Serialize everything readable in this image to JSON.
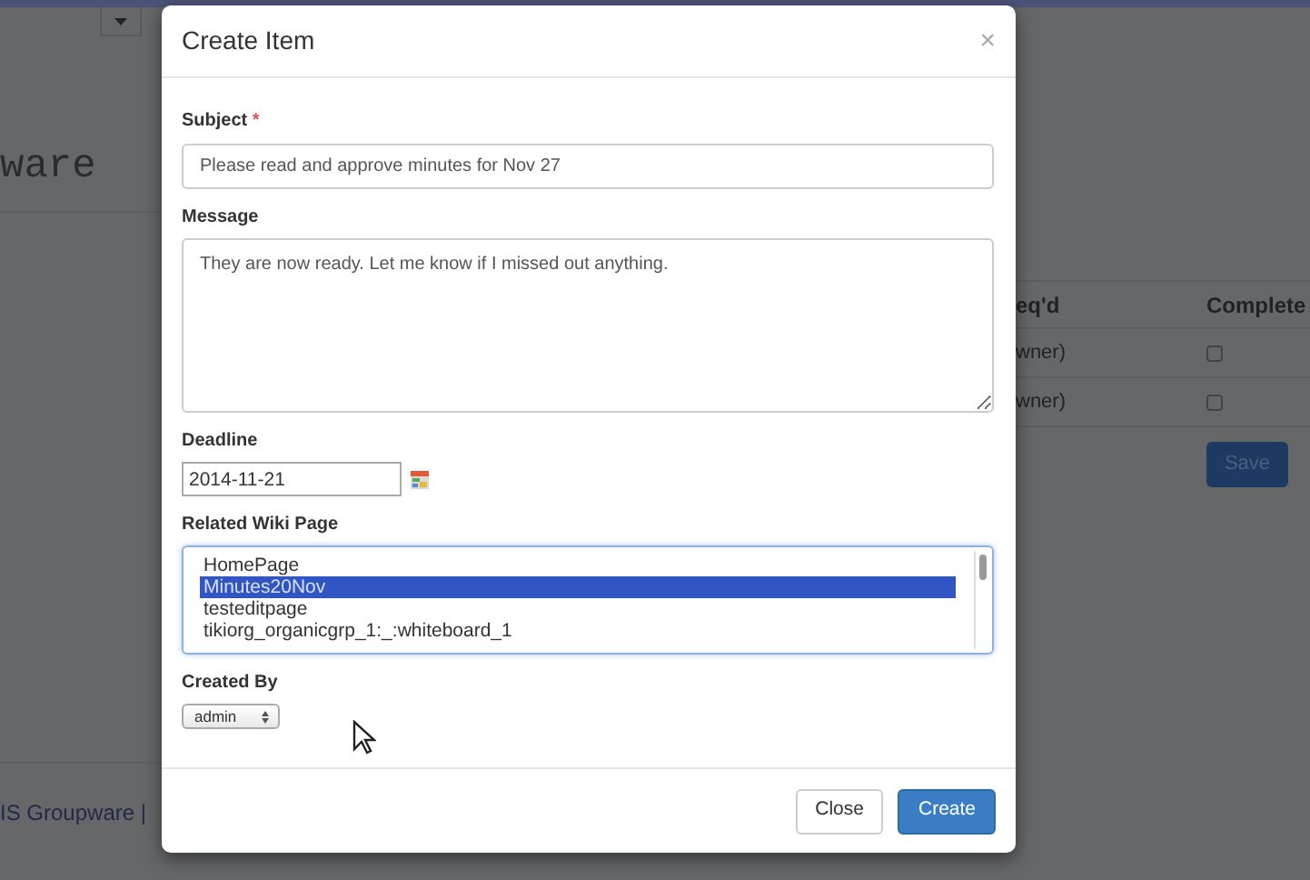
{
  "background": {
    "heading": "ware",
    "footer": "IS Groupware |",
    "table": {
      "columns": [
        "eq'd",
        "Complete"
      ],
      "rows": [
        {
          "cell": "wner)",
          "checked": false
        },
        {
          "cell": "wner)",
          "checked": false
        }
      ]
    },
    "save_button": "Save"
  },
  "modal": {
    "title": "Create Item",
    "close": "×",
    "subject": {
      "label": "Subject",
      "required_marker": "*",
      "value": "Please read and approve minutes for Nov 27"
    },
    "message": {
      "label": "Message",
      "value": "They are now ready. Let me know if I missed out anything."
    },
    "deadline": {
      "label": "Deadline",
      "value": "2014-11-21"
    },
    "related_wiki_page": {
      "label": "Related Wiki Page",
      "options": [
        {
          "text": "HomePage",
          "selected": false
        },
        {
          "text": "Minutes20Nov",
          "selected": true
        },
        {
          "text": "testeditpage",
          "selected": false
        },
        {
          "text": "tikiorg_organicgrp_1:_:whiteboard_1",
          "selected": false
        }
      ]
    },
    "created_by": {
      "label": "Created By",
      "value": "admin"
    },
    "buttons": [
      {
        "label": "Close",
        "kind": "secondary"
      },
      {
        "label": "Create",
        "kind": "primary"
      }
    ]
  }
}
